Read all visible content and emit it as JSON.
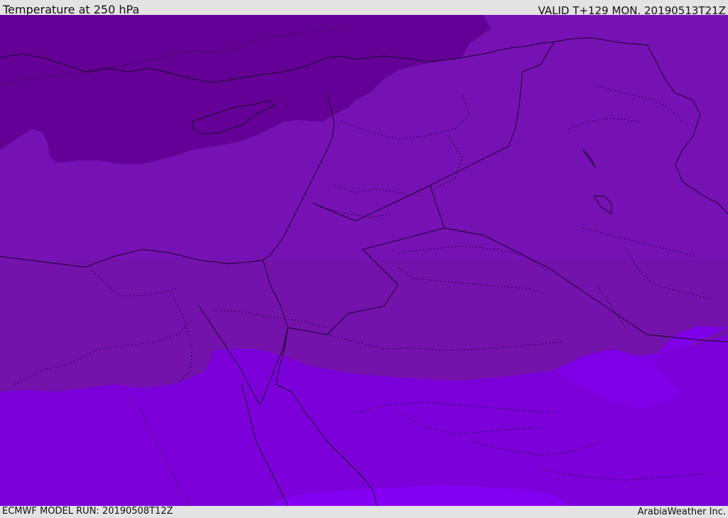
{
  "header": {
    "title": "Temperature at 250 hPa",
    "valid_time": "VALID T+129 MON. 20190513T21Z"
  },
  "footer": {
    "model_run": "ECMWF MODEL RUN: 20190508T12Z",
    "credit": "ArabiaWeather Inc."
  },
  "map": {
    "region": "Eastern Mediterranean / Middle East",
    "colors": {
      "coldest": "#650096",
      "cold": "#7612b3",
      "mid": "#7313ab",
      "warm": "#7c00d9",
      "warmest": "#8400f2",
      "border": "#1a0030"
    }
  }
}
